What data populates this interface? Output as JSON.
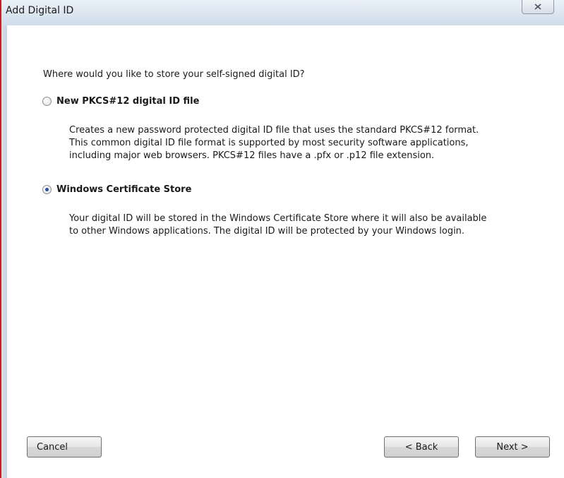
{
  "window": {
    "title": "Add Digital ID",
    "close_icon": "close-icon"
  },
  "question": "Where would you like to store your self-signed digital ID?",
  "options": [
    {
      "label": "New PKCS#12 digital ID file",
      "selected": false,
      "description": [
        "Creates a new password protected digital ID file that uses the standard PKCS#12 format.",
        "This common digital ID file format is supported by most security software applications,",
        "including major web browsers. PKCS#12 files have a .pfx or .p12 file extension."
      ]
    },
    {
      "label": "Windows Certificate Store",
      "selected": true,
      "description": [
        "Your digital ID will be stored in the Windows Certificate Store where it will also be available",
        "to other Windows applications. The digital ID will be protected by your Windows login."
      ]
    }
  ],
  "buttons": {
    "cancel": "Cancel",
    "back": "< Back",
    "next": "Next >"
  },
  "colors": {
    "window_border_accent": "#cc1f1f",
    "radio_dot": "#2a4f9c"
  }
}
